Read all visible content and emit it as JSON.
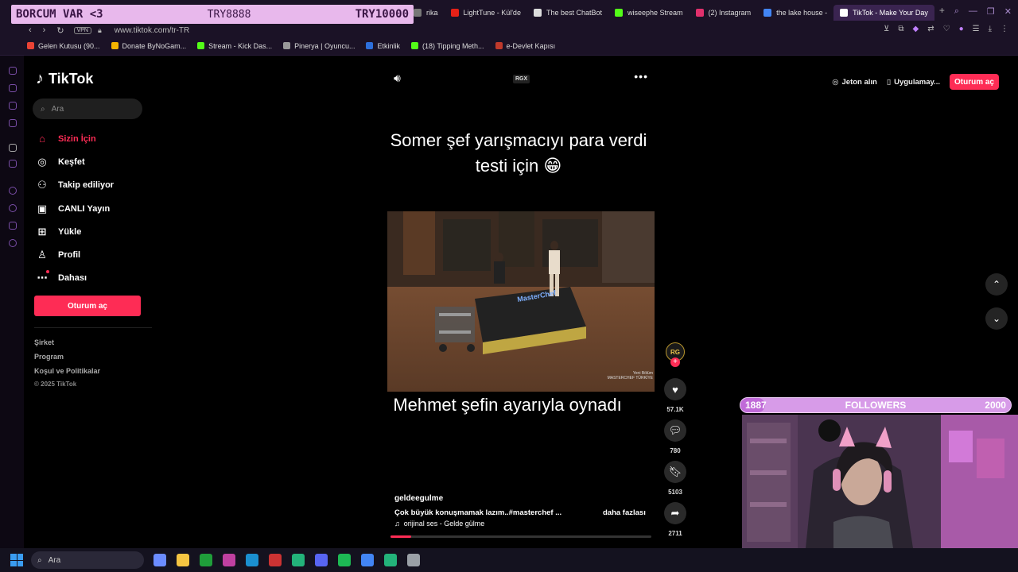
{
  "stream_overlay": {
    "title": "BORCUM VAR <3",
    "current": "TRY8888",
    "goal": "TRY10000",
    "followers_label": "FOLLOWERS",
    "followers_current": "1887",
    "followers_goal": "2000",
    "followers_progress": 0.09
  },
  "browser": {
    "tabs": [
      {
        "label": "rika",
        "color": "#777"
      },
      {
        "label": "LightTune - Kül'de",
        "color": "#e62117"
      },
      {
        "label": "The best ChatBot",
        "color": "#ddd"
      },
      {
        "label": "wiseephe Stream",
        "color": "#53fc18"
      },
      {
        "label": "(2) Instagram",
        "color": "#e1306c"
      },
      {
        "label": "the lake house - ",
        "color": "#4285f4"
      },
      {
        "label": "TikTok - Make Your Day",
        "color": "#fff",
        "active": true
      }
    ],
    "new_tab": "+",
    "vpn_label": "VPN",
    "url": "www.tiktok.com/tr-TR",
    "bookmarks": [
      {
        "label": "Gelen Kutusu (90...",
        "color": "#ea4335"
      },
      {
        "label": "Donate ByNoGam...",
        "color": "#f4b400"
      },
      {
        "label": "Stream - Kick Das...",
        "color": "#53fc18"
      },
      {
        "label": "Pinerya | Oyuncu...",
        "color": "#999"
      },
      {
        "label": "Etkinlik",
        "color": "#2d6fdb"
      },
      {
        "label": "(18) Tipping Meth...",
        "color": "#53fc18"
      },
      {
        "label": "e-Devlet Kapısı",
        "color": "#c0392b"
      }
    ]
  },
  "tiktok": {
    "brand": "TikTok",
    "search_placeholder": "Ara",
    "nav": [
      {
        "label": "Sizin İçin",
        "icon": "home-icon",
        "glyph": "⌂",
        "active": true
      },
      {
        "label": "Keşfet",
        "icon": "compass-icon",
        "glyph": "◎"
      },
      {
        "label": "Takip ediliyor",
        "icon": "following-icon",
        "glyph": "⚇"
      },
      {
        "label": "CANLI Yayın",
        "icon": "live-icon",
        "glyph": "▣"
      },
      {
        "label": "Yükle",
        "icon": "upload-icon",
        "glyph": "⊞"
      },
      {
        "label": "Profil",
        "icon": "profile-icon",
        "glyph": "♙"
      },
      {
        "label": "Dahası",
        "icon": "more-icon",
        "glyph": "⋯"
      }
    ],
    "login": "Oturum aç",
    "footer": {
      "company": "Şirket",
      "program": "Program",
      "terms": "Koşul ve Politikalar",
      "copyright": "© 2025 TikTok"
    },
    "top_actions": {
      "coins": "Jeton alın",
      "app": "Uygulamay...",
      "login": "Oturum aç"
    },
    "video": {
      "badge": "RGX",
      "caption_top": "Somer şef yarışmacıyı para verdi testi için 😁",
      "caption_bottom": "Mehmet şefin ayarıyla oynadı",
      "watermark_line1": "Yeni Bölüm",
      "watermark_line2": "MASTERCHEF TÜRKİYE",
      "creator": "geldeegulme",
      "description": "Çok büyük konuşmamak lazım..#masterchef ...",
      "more": "daha fazlası",
      "music": "orijinal ses - Gelde gülme",
      "progress": 0.08,
      "avatar_text": "RG",
      "likes": "57.1K",
      "comments": "780",
      "saves": "5103",
      "shares": "2711"
    }
  },
  "taskbar": {
    "search_placeholder": "Ara",
    "apps": [
      "#6b8cff",
      "#f5c542",
      "#1f9e3a",
      "#c040a0",
      "#1b90d0",
      "#cc3333",
      "#23b37a",
      "#5865f2",
      "#1db954",
      "#4285f4",
      "#23b37a",
      "#9aa0a6"
    ]
  }
}
